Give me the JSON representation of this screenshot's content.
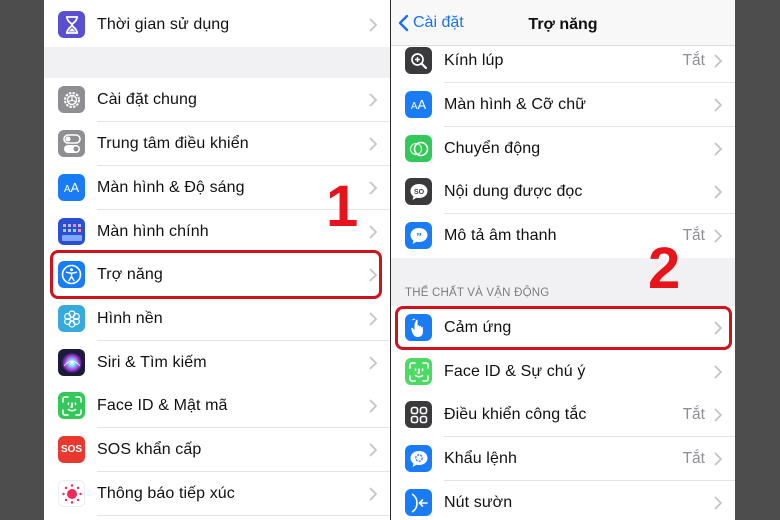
{
  "left_panel": {
    "rows": [
      {
        "label": "Thời gian sử dụng",
        "icon": "hourglass-icon",
        "icon_bg": "#5a4fcf"
      },
      {
        "label": "Cài đặt chung",
        "icon": "gear-icon",
        "icon_bg": "#8e8e93"
      },
      {
        "label": "Trung tâm điều khiển",
        "icon": "toggle-switches-icon",
        "icon_bg": "#8e8e93"
      },
      {
        "label": "Màn hình & Độ sáng",
        "icon": "text-size-aa-icon",
        "icon_bg": "#1a7cf5"
      },
      {
        "label": "Màn hình chính",
        "icon": "home-screen-grid-icon",
        "icon_bg": "#2c4fd1"
      },
      {
        "label": "Trợ năng",
        "icon": "accessibility-person-icon",
        "icon_bg": "#1a7cf5"
      },
      {
        "label": "Hình nền",
        "icon": "wallpaper-flower-icon",
        "icon_bg": "#36aadc"
      },
      {
        "label": "Siri & Tìm kiếm",
        "icon": "siri-icon",
        "icon_bg": "#1c1c3a"
      },
      {
        "label": "Face ID & Mật mã",
        "icon": "face-id-icon",
        "icon_bg": "#34c759"
      },
      {
        "label": "SOS khẩn cấp",
        "icon": "sos-icon",
        "icon_bg": "#e8382f",
        "icon_text": "SOS"
      },
      {
        "label": "Thông báo tiếp xúc",
        "icon": "exposure-notification-icon",
        "icon_bg": "#ffffff"
      }
    ],
    "highlighted_row": "Trợ năng"
  },
  "right_panel": {
    "nav": {
      "back_label": "Cài đặt",
      "title": "Trợ năng"
    },
    "rows_top": [
      {
        "label": "Kính lúp",
        "value": "Tắt",
        "icon": "magnifier-icon",
        "icon_bg": "#3a3a3c"
      },
      {
        "label": "Màn hình & Cỡ chữ",
        "value": "",
        "icon": "text-size-aa-icon",
        "icon_bg": "#1a7cf5"
      },
      {
        "label": "Chuyển động",
        "value": "",
        "icon": "motion-circles-icon",
        "icon_bg": "#34c759"
      },
      {
        "label": "Nội dung được đọc",
        "value": "",
        "icon": "spoken-content-icon",
        "icon_bg": "#3a3a3c"
      },
      {
        "label": "Mô tả âm thanh",
        "value": "Tắt",
        "icon": "audio-description-icon",
        "icon_bg": "#1a7cf5"
      }
    ],
    "section_header": "THỂ CHẤT VÀ VẬN ĐỘNG",
    "rows_bottom": [
      {
        "label": "Cảm ứng",
        "value": "",
        "icon": "touch-hand-icon",
        "icon_bg": "#1a7cf5"
      },
      {
        "label": "Face ID & Sự chú ý",
        "value": "",
        "icon": "face-id-icon",
        "icon_bg": "#4cd964"
      },
      {
        "label": "Điều khiển công tắc",
        "value": "Tắt",
        "icon": "switch-control-icon",
        "icon_bg": "#3a3a3c"
      },
      {
        "label": "Khẩu lệnh",
        "value": "Tắt",
        "icon": "voice-control-icon",
        "icon_bg": "#1a7cf5"
      },
      {
        "label": "Nút sườn",
        "value": "",
        "icon": "side-button-icon",
        "icon_bg": "#1a7cf5"
      }
    ],
    "highlighted_row": "Cảm ứng"
  },
  "annotations": {
    "step1": "1",
    "step2": "2",
    "highlight_color": "#d0121c",
    "number_color": "#e8141c"
  }
}
